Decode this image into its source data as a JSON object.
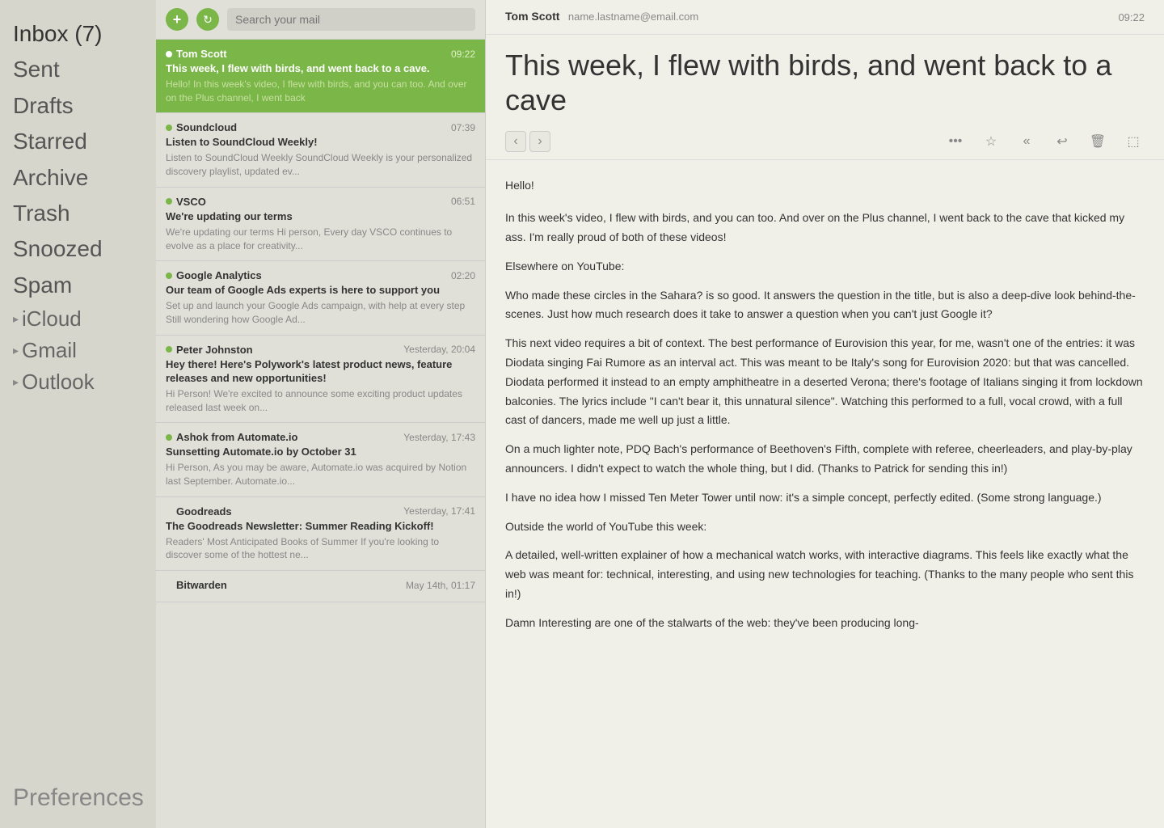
{
  "sidebar": {
    "inbox_label": "Inbox (7)",
    "sent_label": "Sent",
    "drafts_label": "Drafts",
    "starred_label": "Starred",
    "archive_label": "Archive",
    "trash_label": "Trash",
    "snoozed_label": "Snoozed",
    "spam_label": "Spam",
    "icloud_label": "iCloud",
    "gmail_label": "Gmail",
    "outlook_label": "Outlook",
    "preferences_label": "Preferences"
  },
  "email_list": {
    "search_placeholder": "Search your mail",
    "emails": [
      {
        "id": 1,
        "sender": "Tom Scott",
        "time": "09:22",
        "subject": "This week, I flew with birds, and went back to a cave.",
        "preview": "Hello! In this week's video, I flew with birds, and you can too. And over on the Plus channel, I went back",
        "unread": true,
        "active": true
      },
      {
        "id": 2,
        "sender": "Soundcloud",
        "time": "07:39",
        "subject": "Listen to SoundCloud Weekly!",
        "preview": "Listen to SoundCloud Weekly SoundCloud Weekly is your personalized discovery playlist, updated ev...",
        "unread": true,
        "active": false
      },
      {
        "id": 3,
        "sender": "VSCO",
        "time": "06:51",
        "subject": "We're updating our terms",
        "preview": "We're updating our terms Hi person, Every day VSCO continues to evolve as a place for creativity...",
        "unread": true,
        "active": false
      },
      {
        "id": 4,
        "sender": "Google Analytics",
        "time": "02:20",
        "subject": "Our team of Google Ads experts is here to support you",
        "preview": "Set up and launch your Google Ads campaign, with help at every step Still wondering how Google Ad...",
        "unread": true,
        "active": false
      },
      {
        "id": 5,
        "sender": "Peter Johnston",
        "time": "Yesterday, 20:04",
        "subject": "Hey there! Here's Polywork's latest product news, feature releases and new opportunities!",
        "preview": "Hi Person! We're excited to announce some exciting product updates released last week on...",
        "unread": true,
        "active": false
      },
      {
        "id": 6,
        "sender": "Ashok from Automate.io",
        "time": "Yesterday, 17:43",
        "subject": "Sunsetting Automate.io by October 31",
        "preview": "Hi Person, As you may be aware, Automate.io was acquired by Notion last September. Automate.io...",
        "unread": true,
        "active": false
      },
      {
        "id": 7,
        "sender": "Goodreads",
        "time": "Yesterday, 17:41",
        "subject": "The Goodreads Newsletter: Summer Reading Kickoff!",
        "preview": "Readers' Most Anticipated Books of Summer If you're looking to discover some of the hottest ne...",
        "unread": false,
        "active": false
      },
      {
        "id": 8,
        "sender": "Bitwarden",
        "time": "May 14th, 01:17",
        "subject": "",
        "preview": "",
        "unread": false,
        "active": false
      }
    ]
  },
  "email_content": {
    "from_name": "Tom Scott",
    "from_email": "name.lastname@email.com",
    "time": "09:22",
    "subject": "This week, I flew with birds, and went back to a cave",
    "greeting": "Hello!",
    "body_paragraphs": [
      "In this week's video, I flew with birds, and you can too. And over on the Plus channel, I went back to the cave that kicked my ass. I'm really proud of both of these videos!",
      "Elsewhere on YouTube:",
      "   Who made these circles in the Sahara? is so good. It answers the question in the title, but is also a deep-dive look behind-the-scenes. Just how much research does it take to answer a question when you can't just Google it?",
      "   This next video requires a bit of context. The best performance of Eurovision this year, for me, wasn't one of the entries: it was Diodata singing Fai Rumore as an interval act. This was meant to be Italy's song for Eurovision 2020: but that was cancelled. Diodata performed it instead to an empty amphitheatre in a deserted Verona; there's footage of Italians singing it from lockdown balconies. The lyrics include \"I can't bear it, this unnatural silence\". Watching this performed to a full, vocal crowd, with a full cast of dancers, made me well up just a little.",
      "   On a much lighter note, PDQ Bach's performance of Beethoven's Fifth, complete with referee, cheerleaders, and play-by-play announcers. I didn't expect to watch the whole thing, but I did. (Thanks to Patrick for sending this in!)",
      "   I have no idea how I missed Ten Meter Tower until now: it's a simple concept, perfectly edited. (Some strong language.)",
      "Outside the world of YouTube this week:",
      "   A detailed, well-written explainer of how a mechanical watch works, with interactive diagrams. This feels like exactly what the web was meant for: technical, interesting, and using new technologies for teaching. (Thanks to the many people who sent this in!)",
      "   Damn Interesting are one of the stalwarts of the web: they've been producing long-"
    ]
  },
  "icons": {
    "compose": "+",
    "refresh": "↻",
    "prev_email": "‹",
    "next_email": "›",
    "more": "•••",
    "star": "☆",
    "reply_all": "«",
    "reply": "↩",
    "trash": "🗑",
    "archive": "⬚"
  }
}
